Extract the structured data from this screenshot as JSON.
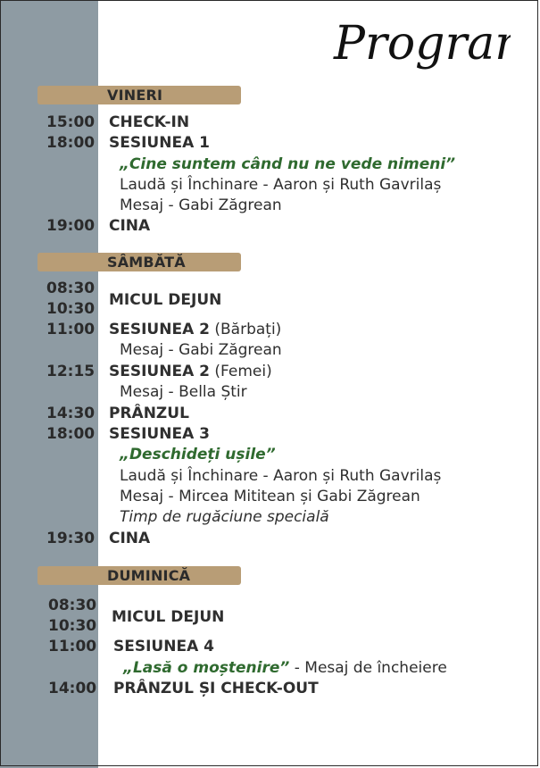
{
  "title": "Program",
  "colors": {
    "band": "#8e9ba3",
    "pill": "#b89d76",
    "quote": "#2f6a2f"
  },
  "days": [
    {
      "name": "VINERI"
    },
    {
      "name": "SÂMBĂTĂ"
    },
    {
      "name": "DUMINICĂ"
    }
  ],
  "friday": {
    "r1_time": "15:00",
    "r1_text": "CHECK-IN",
    "r2_time": "18:00",
    "r2_text": "SESIUNEA 1",
    "r2_quote": "„Cine suntem când nu ne vede nimeni”",
    "r2_line2": "Laudă și Închinare - Aaron și Ruth Gavrilaș",
    "r2_line3": "Mesaj - Gabi Zăgrean",
    "r3_time": "19:00",
    "r3_text": "CINA"
  },
  "saturday": {
    "r1_time_a": "08:30",
    "r1_time_b": "10:30",
    "r1_text": "MICUL DEJUN",
    "r2_time": "11:00",
    "r2_text_bold": "SESIUNEA 2",
    "r2_text_rest": " (Bărbați)",
    "r2_line2": "Mesaj - Gabi Zăgrean",
    "r3_time": "12:15",
    "r3_text_bold": "SESIUNEA 2",
    "r3_text_rest": " (Femei)",
    "r3_line2": "Mesaj - Bella Știr",
    "r4_time": "14:30",
    "r4_text": "PRÂNZUL",
    "r5_time": "18:00",
    "r5_text": "SESIUNEA 3",
    "r5_quote": "„Deschideți ușile”",
    "r5_line2": "Laudă și Închinare - Aaron și Ruth Gavrilaș",
    "r5_line3": "Mesaj - Mircea Mititean și Gabi Zăgrean",
    "r5_line4": "Timp de rugăciune specială",
    "r6_time": "19:30",
    "r6_text": "CINA"
  },
  "sunday": {
    "r1_time_a": "08:30",
    "r1_time_b": "10:30",
    "r1_text": "MICUL DEJUN",
    "r2_time": "11:00",
    "r2_text": "SESIUNEA 4",
    "r2_quote": "„Lasă o moștenire”",
    "r2_rest": " - Mesaj de încheiere",
    "r3_time": "14:00",
    "r3_text": "PRÂNZUL ȘI CHECK-OUT"
  }
}
